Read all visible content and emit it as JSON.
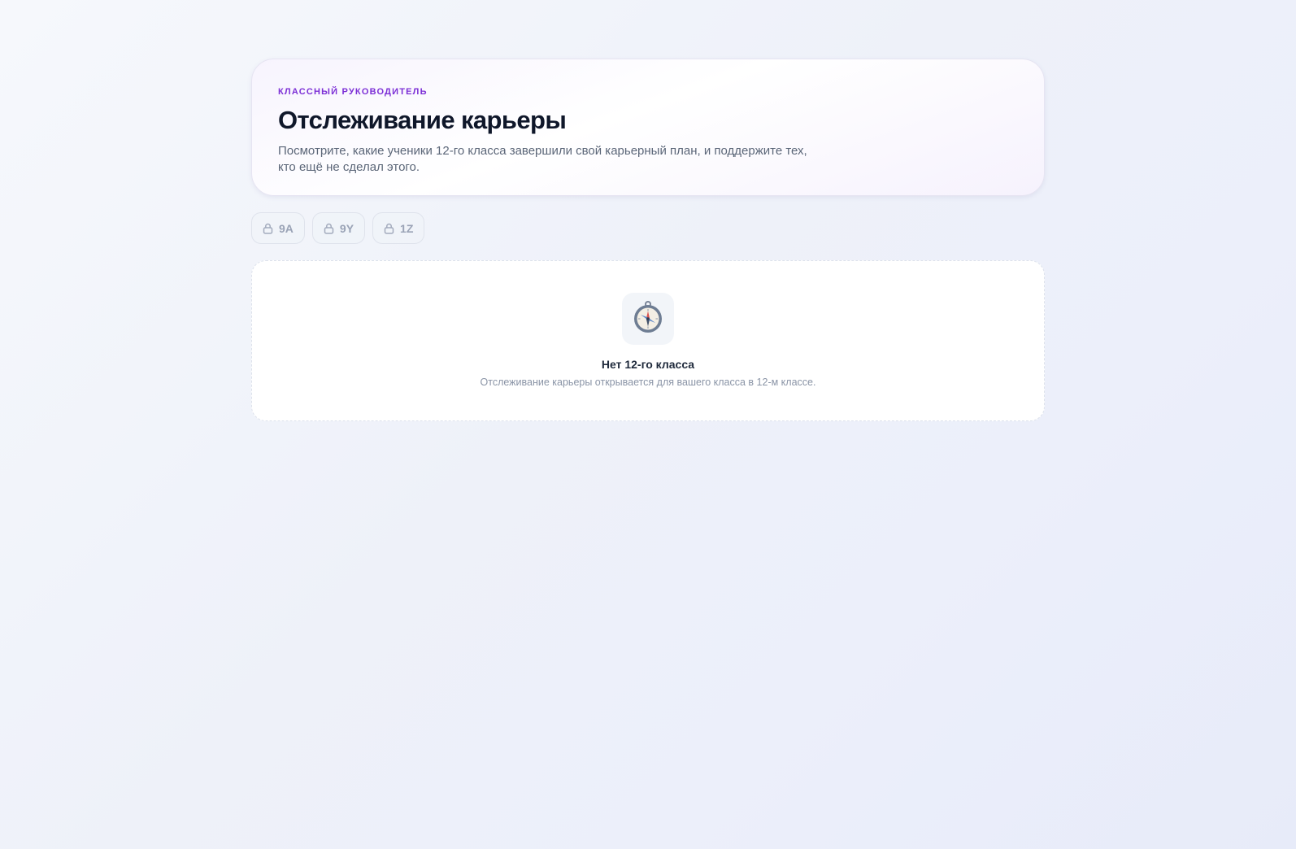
{
  "header": {
    "eyebrow": "КЛАССНЫЙ РУКОВОДИТЕЛЬ",
    "title": "Отслеживание карьеры",
    "description": "Посмотрите, какие ученики 12-го класса завершили свой карьерный план, и поддержите тех, кто ещё не сделал этого."
  },
  "class_tabs": [
    {
      "label": "9A",
      "icon": "lock-icon",
      "locked": true
    },
    {
      "label": "9Y",
      "icon": "lock-icon",
      "locked": true
    },
    {
      "label": "1Z",
      "icon": "lock-icon",
      "locked": true
    }
  ],
  "empty_state": {
    "icon": "compass-icon",
    "title": "Нет 12-го класса",
    "description": "Отслеживание карьеры открывается для вашего класса в 12-м классе."
  },
  "colors": {
    "accent": "#7c2fd6",
    "title": "#0f172a",
    "muted": "#5b6678",
    "tab_text": "#9aa3b6"
  }
}
